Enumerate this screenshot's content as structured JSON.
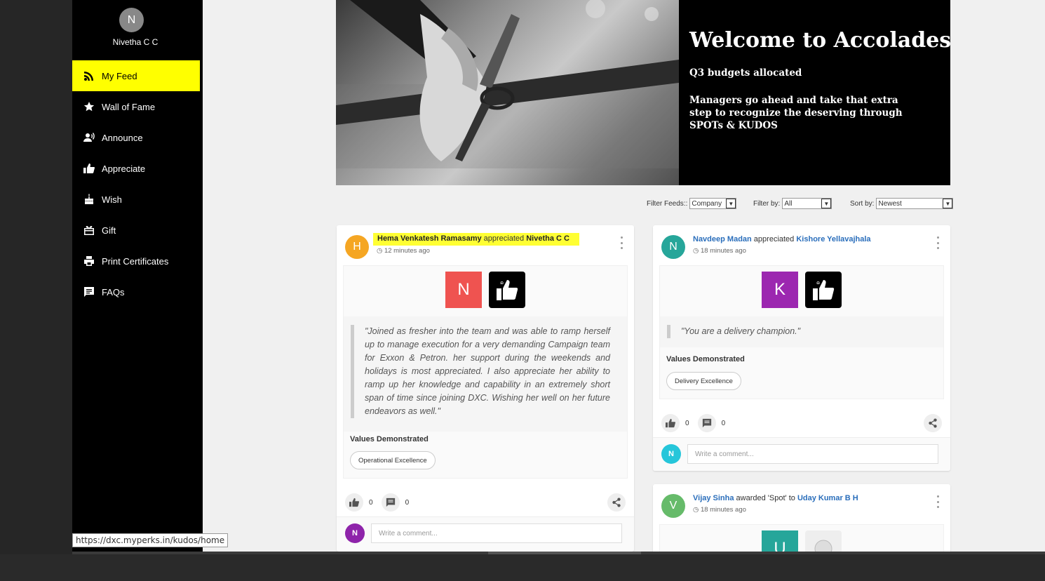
{
  "user": {
    "initial": "N",
    "name": "Nivetha C C"
  },
  "nav": {
    "items": [
      {
        "label": "My Feed",
        "icon": "rss-icon",
        "active": true
      },
      {
        "label": "Wall of Fame",
        "icon": "star-icon"
      },
      {
        "label": "Announce",
        "icon": "announce-icon"
      },
      {
        "label": "Appreciate",
        "icon": "thumbs-up-icon"
      },
      {
        "label": "Wish",
        "icon": "cake-icon"
      },
      {
        "label": "Gift",
        "icon": "gift-icon"
      },
      {
        "label": "Print Certificates",
        "icon": "print-icon"
      },
      {
        "label": "FAQs",
        "icon": "faq-icon"
      }
    ]
  },
  "banner": {
    "title": "Welcome to Accolades",
    "subtitle": "Q3 budgets allocated",
    "body": "Managers go ahead and take that extra step to recognize the deserving through SPOTs & KUDOS"
  },
  "filters": {
    "feed_label": "Filter Feeds::",
    "feed_value": "Company",
    "filter_label": "Filter by:",
    "filter_value": "All",
    "sort_label": "Sort by:",
    "sort_value": "Newest"
  },
  "posts": [
    {
      "avatar": "H",
      "avatar_color": "#f5a623",
      "actor": "Hema Venkatesh Ramasamy",
      "verb": " appreciated ",
      "target": "Nivetha C C",
      "time": "12 minutes ago",
      "tile": "N",
      "tile_color": "#ef5350",
      "quote": "\"Joined as fresher into the team and was able to ramp herself up to manage execution for a very demanding Campaign team for Exxon & Petron. her support during the weekends and holidays is most appreciated. I also appreciate her ability to ramp up her knowledge and capability in an extremely short span of time since joining DXC. Wishing her well on her future endeavors as well.\"",
      "values_title": "Values Demonstrated",
      "value": "Operational Excellence",
      "likes": "0",
      "comments": "0",
      "comment_placeholder": "Write a comment...",
      "commenter": "N"
    },
    {
      "avatar": "N",
      "avatar_color": "#26a69a",
      "actor": "Navdeep Madan",
      "verb": " appreciated ",
      "target": "Kishore Yellavajhala",
      "time": "18 minutes ago",
      "tile": "K",
      "tile_color": "#9c27b0",
      "quote": "\"You are a delivery champion.\"",
      "values_title": "Values Demonstrated",
      "value": "Delivery Excellence",
      "likes": "0",
      "comments": "0",
      "comment_placeholder": "Write a comment...",
      "commenter": "N"
    },
    {
      "avatar": "V",
      "avatar_color": "#66bb6a",
      "actor": "Vijay Sinha",
      "verb": " awarded 'Spot' to ",
      "target": "Uday Kumar B H",
      "time": "18 minutes ago",
      "tile": "U",
      "tile_color": "#26a69a"
    }
  ],
  "status_url": "https://dxc.myperks.in/kudos/home"
}
